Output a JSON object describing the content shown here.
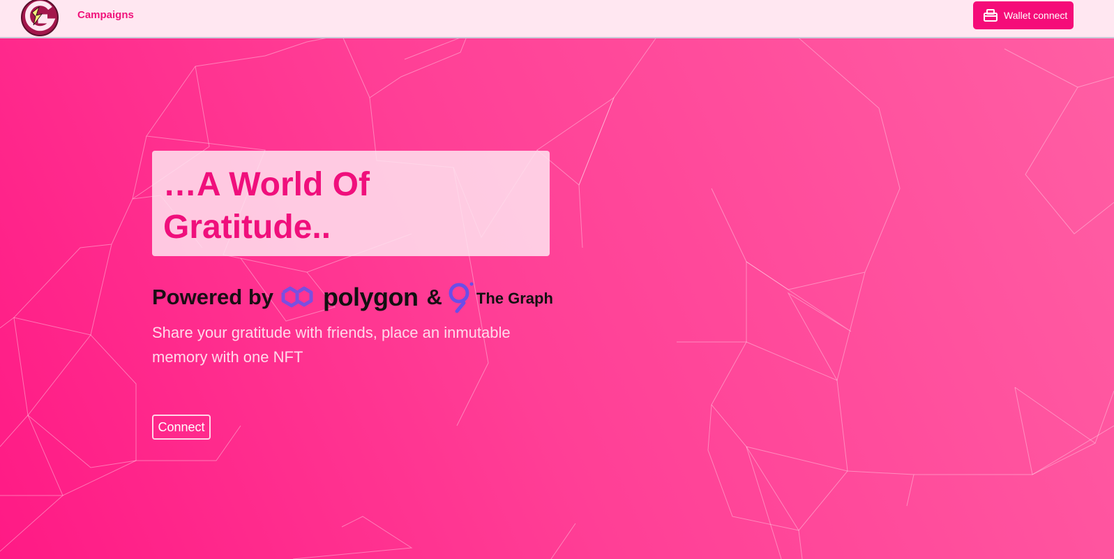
{
  "header": {
    "logo_icon": "gratitude-g-logo-icon",
    "nav_link": "Campaigns",
    "wallet_button_label": "Wallet connect",
    "wallet_icon": "wallet-icon"
  },
  "hero": {
    "title": "…A World Of Gratitude..",
    "powered_by_label": "Powered by",
    "polygon_icon": "polygon-logo-icon",
    "polygon_label": "polygon",
    "ampersand": "&",
    "graph_icon": "the-graph-logo-icon",
    "graph_label": "The Graph",
    "description": "Share your gratitude with friends, place an inmutable memory with one NFT",
    "connect_label": "Connect"
  },
  "colors": {
    "accent": "#f50c79",
    "title_pink": "#f00f7c",
    "header_bg": "#ffe7f1",
    "polygon_purple": "#8247e5",
    "graph_blue": "#6747ed",
    "background_start": "#ff1a85",
    "background_end": "#ff5fa4"
  }
}
